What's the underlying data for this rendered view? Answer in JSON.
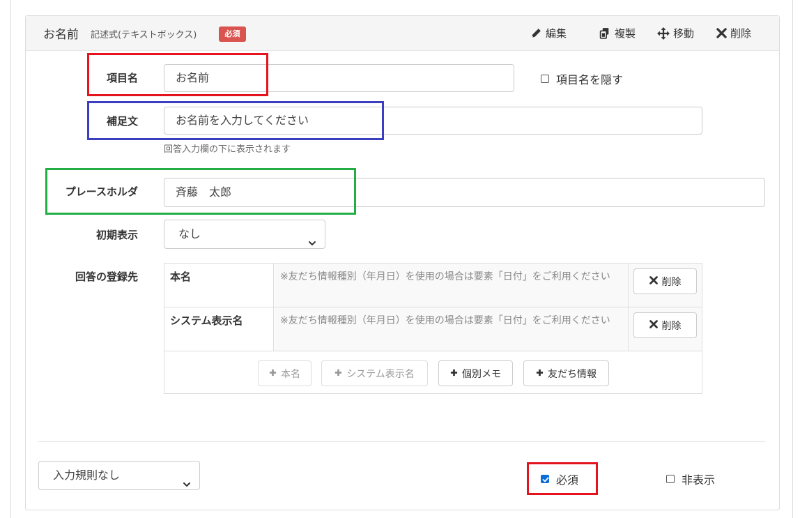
{
  "header": {
    "title": "お名前",
    "type": "記述式(テキストボックス)",
    "badge": "必須",
    "actions": [
      {
        "label": "編集",
        "icon": "pencil-icon"
      },
      {
        "label": "複製",
        "icon": "duplicate-icon"
      },
      {
        "label": "移動",
        "icon": "move-icon"
      },
      {
        "label": "削除",
        "icon": "close-icon"
      }
    ]
  },
  "form": {
    "item_name": {
      "label": "項目名",
      "value": "お名前"
    },
    "hide_item_name": {
      "label": "項目名を隠す",
      "checked": false
    },
    "supplement": {
      "label": "補足文",
      "value": "お名前を入力してください",
      "help": "回答入力欄の下に表示されます"
    },
    "placeholder": {
      "label": "プレースホルダ",
      "value": "斉藤　太郎"
    },
    "initial_display": {
      "label": "初期表示",
      "value": "なし"
    }
  },
  "destination": {
    "label": "回答の登録先",
    "rows": [
      {
        "name": "本名",
        "note": "※友だち情報種別（年月日）を使用の場合は要素「日付」をご利用ください",
        "action": "削除"
      },
      {
        "name": "システム表示名",
        "note": "※友だち情報種別（年月日）を使用の場合は要素「日付」をご利用ください",
        "action": "削除"
      }
    ],
    "add_buttons": [
      {
        "label": "本名",
        "disabled": true
      },
      {
        "label": "システム表示名",
        "disabled": true
      },
      {
        "label": "個別メモ",
        "disabled": false
      },
      {
        "label": "友だち情報",
        "disabled": false
      }
    ]
  },
  "footer": {
    "validation": {
      "value": "入力規則なし"
    },
    "required": {
      "label": "必須",
      "checked": true
    },
    "hidden": {
      "label": "非表示",
      "checked": false
    }
  },
  "colors": {
    "badge": "#d9534f",
    "checkbox": "#0b6ed8",
    "highlight_red": "#e5131d",
    "highlight_blue": "#3b3fbf",
    "highlight_green": "#22ad45"
  }
}
